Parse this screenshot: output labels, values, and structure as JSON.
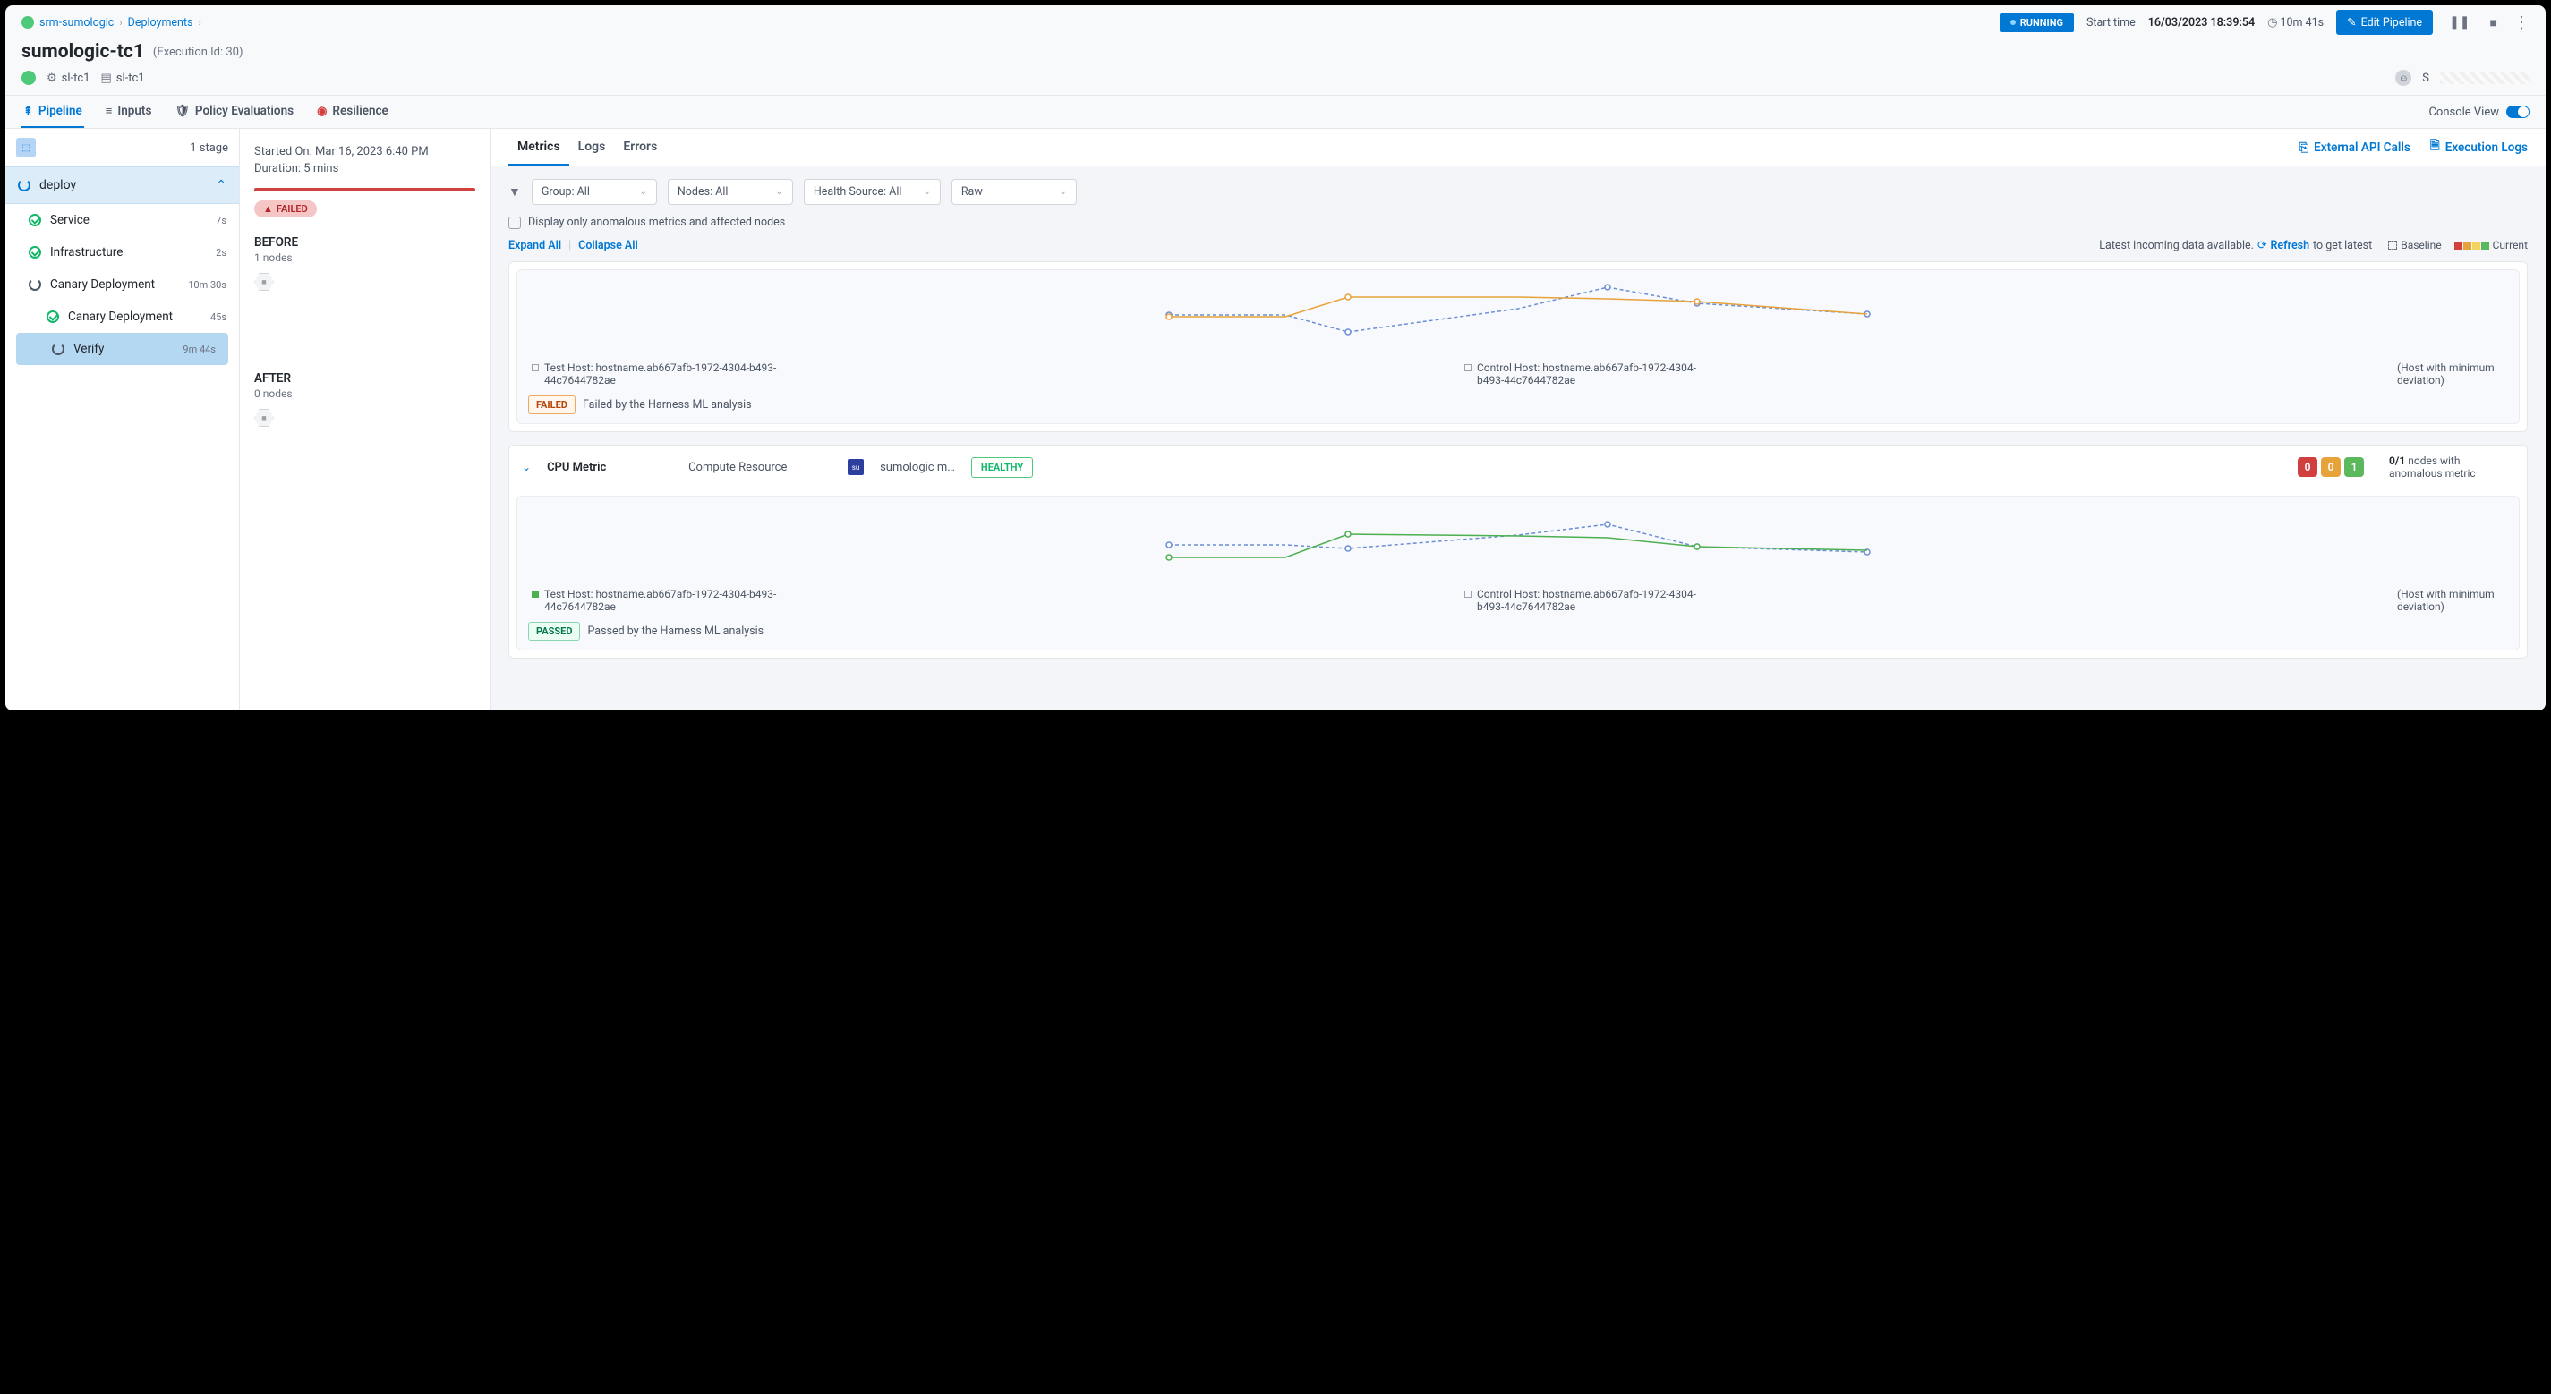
{
  "breadcrumb": {
    "project": "srm-sumologic",
    "section": "Deployments"
  },
  "title": "sumologic-tc1",
  "exec_id": "(Execution Id: 30)",
  "status": "RUNNING",
  "start_label": "Start time",
  "start_time": "16/03/2023 18:39:54",
  "elapsed": "10m 41s",
  "edit_btn": "Edit Pipeline",
  "pills": {
    "a": "sl-tc1",
    "b": "sl-tc1"
  },
  "main_tabs": {
    "pipeline": "Pipeline",
    "inputs": "Inputs",
    "policy": "Policy Evaluations",
    "resilience": "Resilience"
  },
  "console_view": "Console View",
  "stage_count": "1 stage",
  "deploy": "deploy",
  "steps": {
    "service": {
      "name": "Service",
      "dur": "7s"
    },
    "infra": {
      "name": "Infrastructure",
      "dur": "2s"
    },
    "canary": {
      "name": "Canary Deployment",
      "dur": "10m 30s"
    },
    "canary_sub": {
      "name": "Canary Deployment",
      "dur": "45s"
    },
    "verify": {
      "name": "Verify",
      "dur": "9m 44s"
    }
  },
  "detail": {
    "started": "Started On: Mar 16, 2023 6:40 PM",
    "duration": "Duration: 5 mins",
    "failed": "FAILED",
    "before_hdr": "BEFORE",
    "before_sub": "1 nodes",
    "after_hdr": "AFTER",
    "after_sub": "0 nodes"
  },
  "content_tabs": {
    "metrics": "Metrics",
    "logs": "Logs",
    "errors": "Errors"
  },
  "links": {
    "api": "External API Calls",
    "exec": "Execution Logs"
  },
  "filters": {
    "group": "Group: All",
    "nodes": "Nodes: All",
    "health": "Health Source: All",
    "agg": "Raw"
  },
  "anom_check": "Display only anomalous metrics and affected nodes",
  "expand": "Expand All",
  "collapse": "Collapse All",
  "latest": "Latest incoming data available.",
  "refresh": "Refresh",
  "latest_tail": "to get latest",
  "legend": {
    "baseline": "Baseline",
    "current": "Current"
  },
  "card1": {
    "test_host": "Test Host: hostname.ab667afb-1972-4304-b493-44c7644782ae",
    "control_host": "Control Host: hostname.ab667afb-1972-4304-b493-44c7644782ae",
    "min_dev": "(Host with minimum deviation)",
    "status": "FAILED",
    "msg": "Failed by the Harness ML analysis"
  },
  "card2": {
    "name": "CPU Metric",
    "type": "Compute Resource",
    "src": "sumologic m…",
    "health": "HEALTHY",
    "c0": "0",
    "c1": "0",
    "c2": "1",
    "anom_count": "0/1",
    "anom_text": "nodes with anomalous metric",
    "test_host": "Test Host: hostname.ab667afb-1972-4304-b493-44c7644782ae",
    "control_host": "Control Host: hostname.ab667afb-1972-4304-b493-44c7644782ae",
    "min_dev": "(Host with minimum deviation)",
    "status": "PASSED",
    "msg": "Passed by the Harness ML analysis"
  },
  "chart_data": [
    {
      "type": "line",
      "series": [
        {
          "name": "Test (solid)",
          "values": [
            50,
            50,
            72,
            72,
            70,
            66,
            35
          ],
          "color": "#e8a23a"
        },
        {
          "name": "Control (dashed)",
          "values": [
            50,
            50,
            26,
            64,
            88,
            62,
            35
          ],
          "color": "#6b8ed6",
          "dashed": true
        }
      ],
      "x": [
        0,
        1,
        2,
        3,
        4,
        5,
        6
      ],
      "ylim": [
        0,
        100
      ]
    },
    {
      "type": "line",
      "series": [
        {
          "name": "Test (solid)",
          "values": [
            28,
            28,
            60,
            58,
            55,
            42,
            38
          ],
          "color": "#4caf50"
        },
        {
          "name": "Control (dashed)",
          "values": [
            45,
            45,
            40,
            58,
            74,
            42,
            30
          ],
          "color": "#6b8ed6",
          "dashed": true
        }
      ],
      "x": [
        0,
        1,
        2,
        3,
        4,
        5,
        6
      ],
      "ylim": [
        0,
        100
      ]
    }
  ]
}
